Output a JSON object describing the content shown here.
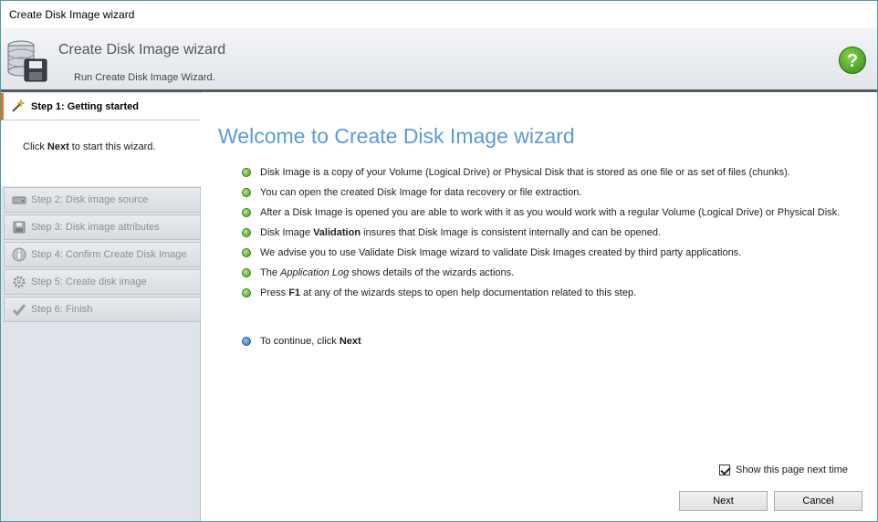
{
  "window": {
    "title": "Create Disk Image wizard"
  },
  "header": {
    "title": "Create Disk Image wizard",
    "subtitle": "Run Create Disk Image Wizard.",
    "help_glyph": "?"
  },
  "sidebar": {
    "active_step": {
      "label": "Step 1: Getting started",
      "icon": "wand-icon"
    },
    "active_desc": {
      "pre": "Click ",
      "bold": "Next",
      "post": " to start this wizard."
    },
    "steps": [
      {
        "label": "Step 2: Disk image source",
        "icon": "disk-icon"
      },
      {
        "label": "Step 3: Disk image attributes",
        "icon": "floppy-icon"
      },
      {
        "label": "Step 4: Confirm Create Disk Image",
        "icon": "info-icon"
      },
      {
        "label": "Step 5: Create disk image",
        "icon": "gear-icon"
      },
      {
        "label": "Step 6: Finish",
        "icon": "checkmark-icon"
      }
    ]
  },
  "main": {
    "heading": "Welcome to Create Disk Image wizard",
    "bullets": [
      {
        "a": "Disk Image is a copy of your Volume (Logical Drive) or Physical Disk that is stored as one file or as set of files (chunks).",
        "b": "",
        "c": ""
      },
      {
        "a": "You can open the created Disk Image for data recovery or file extraction.",
        "b": "",
        "c": ""
      },
      {
        "a": "After a Disk Image is opened you are able to work with it as you would work with a regular Volume (Logical Drive) or Physical Disk.",
        "b": "",
        "c": ""
      },
      {
        "a": "Disk Image ",
        "b": "Validation",
        "c": " insures that Disk Image is consistent internally and can be opened."
      },
      {
        "a": "We advise you to use Validate Disk Image wizard to validate Disk Images created by third party applications.",
        "b": "",
        "c": ""
      },
      {
        "a": "The ",
        "i": "Application Log",
        "c": " shows details of the wizards actions."
      },
      {
        "a": "Press ",
        "b": "F1",
        "c": " at any of the wizards steps to open help documentation related to this step."
      }
    ],
    "continue": {
      "pre": "To continue, click ",
      "bold": "Next"
    },
    "show_next_time": {
      "label": "Show this page next time",
      "checked": true
    },
    "buttons": {
      "next": "Next",
      "cancel": "Cancel"
    }
  },
  "colors": {
    "accent": "#5b9bd5",
    "active_step_marker": "#d8772b",
    "bullet_green": "#4a9a24",
    "bullet_blue": "#2f6fb0"
  }
}
